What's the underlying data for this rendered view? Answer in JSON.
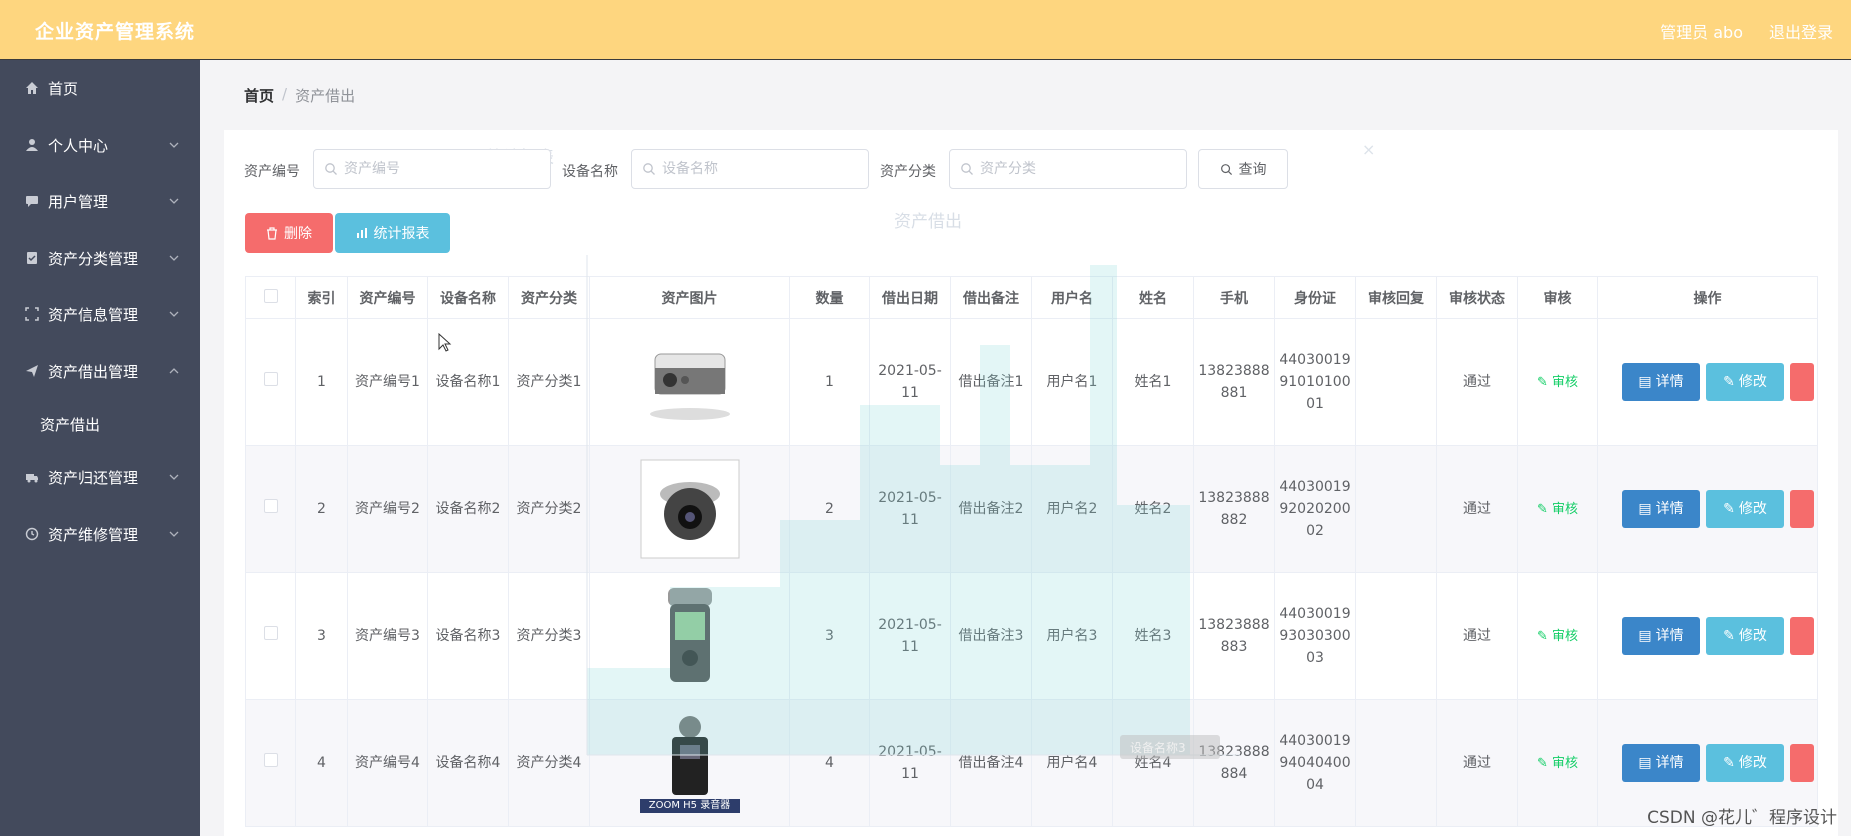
{
  "header": {
    "app_title": "企业资产管理系统",
    "admin_label": "管理员 abo",
    "logout_label": "退出登录"
  },
  "sidebar": {
    "items": [
      {
        "label": "首页",
        "icon": "home-icon"
      },
      {
        "label": "个人中心",
        "icon": "user-icon"
      },
      {
        "label": "用户管理",
        "icon": "chat-icon"
      },
      {
        "label": "资产分类管理",
        "icon": "tag-icon"
      },
      {
        "label": "资产信息管理",
        "icon": "frame-icon"
      },
      {
        "label": "资产借出管理",
        "icon": "send-icon"
      },
      {
        "label": "资产归还管理",
        "icon": "truck-icon"
      },
      {
        "label": "资产维修管理",
        "icon": "clock-icon"
      }
    ],
    "sub_items": [
      {
        "label": "资产借出"
      }
    ]
  },
  "breadcrumb": {
    "home": "首页",
    "separator": "/",
    "current": "资产借出"
  },
  "search": {
    "asset_no_label": "资产编号",
    "asset_no_placeholder": "资产编号",
    "device_name_label": "设备名称",
    "device_name_placeholder": "设备名称",
    "category_label": "资产分类",
    "category_placeholder": "资产分类",
    "query_label": "查询"
  },
  "toolbar": {
    "delete_label": "删除",
    "report_label": "统计报表"
  },
  "table": {
    "headers": [
      "索引",
      "资产编号",
      "设备名称",
      "资产分类",
      "资产图片",
      "数量",
      "借出日期",
      "借出备注",
      "用户名",
      "姓名",
      "手机",
      "身份证",
      "审核回复",
      "审核状态",
      "审核",
      "操作"
    ],
    "audit_label": "审核",
    "detail_label": "详情",
    "edit_label": "修改",
    "rows": [
      {
        "index": "1",
        "asset_no": "资产编号1",
        "device": "设备名称1",
        "category": "资产分类1",
        "qty": "1",
        "date": "2021-05-11",
        "note": "借出备注1",
        "username": "用户名1",
        "name": "姓名1",
        "phone": "13823888881",
        "id": "440300199101010001",
        "reply": "",
        "status": "通过"
      },
      {
        "index": "2",
        "asset_no": "资产编号2",
        "device": "设备名称2",
        "category": "资产分类2",
        "qty": "2",
        "date": "2021-05-11",
        "note": "借出备注2",
        "username": "用户名2",
        "name": "姓名2",
        "phone": "13823888882",
        "id": "440300199202020002",
        "reply": "",
        "status": "通过"
      },
      {
        "index": "3",
        "asset_no": "资产编号3",
        "device": "设备名称3",
        "category": "资产分类3",
        "qty": "3",
        "date": "2021-05-11",
        "note": "借出备注3",
        "username": "用户名3",
        "name": "姓名3",
        "phone": "13823888883",
        "id": "440300199303030003",
        "reply": "",
        "status": "通过"
      },
      {
        "index": "4",
        "asset_no": "资产编号4",
        "device": "设备名称4",
        "category": "资产分类4",
        "qty": "4",
        "date": "2021-05-11",
        "note": "借出备注4",
        "username": "用户名4",
        "name": "姓名4",
        "phone": "13823888884",
        "id": "440300199404040004",
        "reply": "",
        "status": "通过"
      }
    ],
    "image_caption": "ZOOM H5 录音器"
  },
  "overlay": {
    "title": "统计报表",
    "chart_title": "资产借出",
    "close": "×",
    "tooltip": "设备名称3"
  },
  "watermark": "CSDN @花儿゛程序设计",
  "colors": {
    "topbar": "#fed67f",
    "sidebar": "#434a5c",
    "danger": "#f56c6c",
    "info": "#5bc0de",
    "primary": "#3b86c9",
    "success": "#13ce66"
  }
}
